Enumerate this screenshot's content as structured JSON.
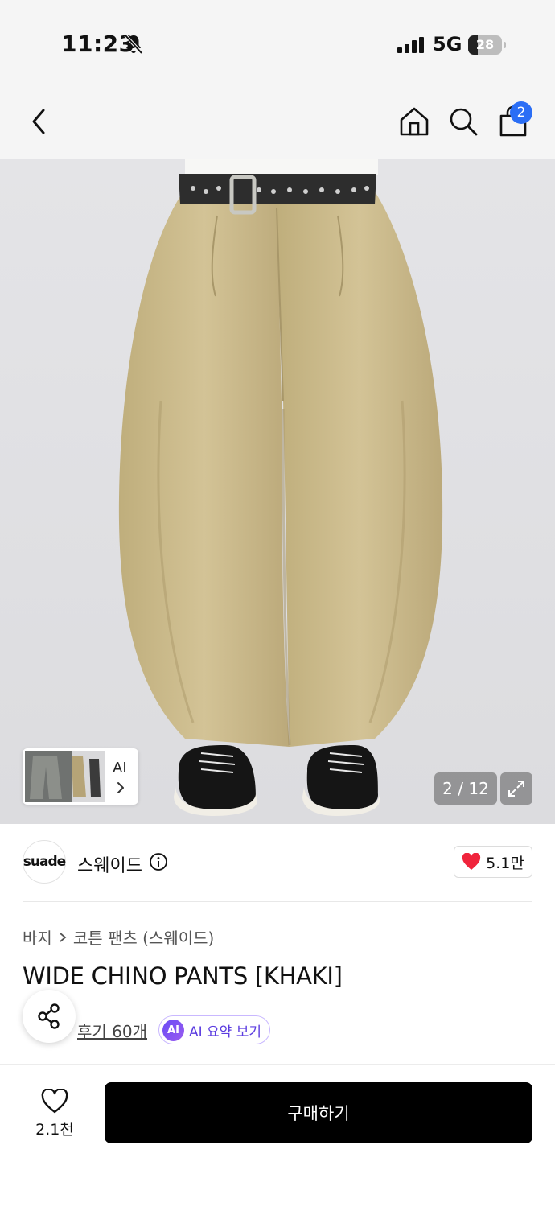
{
  "status_bar": {
    "time": "11:23",
    "network": "5G",
    "battery_level": "28",
    "battery_fraction": 0.28,
    "icons": [
      "bell-slash-icon",
      "signal-bars-icon",
      "battery-icon"
    ]
  },
  "header": {
    "icons": [
      "chevron-left-icon",
      "home-icon",
      "search-icon",
      "shopping-bag-icon"
    ],
    "cart_count": "2",
    "accent_color": "#2b6ef5"
  },
  "gallery": {
    "counter": "2 / 12",
    "ai_label": "AI",
    "icons": [
      "expand-icon",
      "chevron-right-icon"
    ]
  },
  "brand": {
    "logo_text": "suade",
    "name": "스웨이드",
    "likes": "5.1만",
    "heart_color": "#f0243c"
  },
  "product": {
    "breadcrumb": [
      "바지",
      "코튼 팬츠 (스웨이드)"
    ],
    "title": "WIDE CHINO PANTS [KHAKI]",
    "review_link": "후기 60개",
    "ai_badge": "AI",
    "ai_summary": "AI 요약 보기"
  },
  "bottom_bar": {
    "wish_count": "2.1천",
    "buy_label": "구매하기"
  }
}
